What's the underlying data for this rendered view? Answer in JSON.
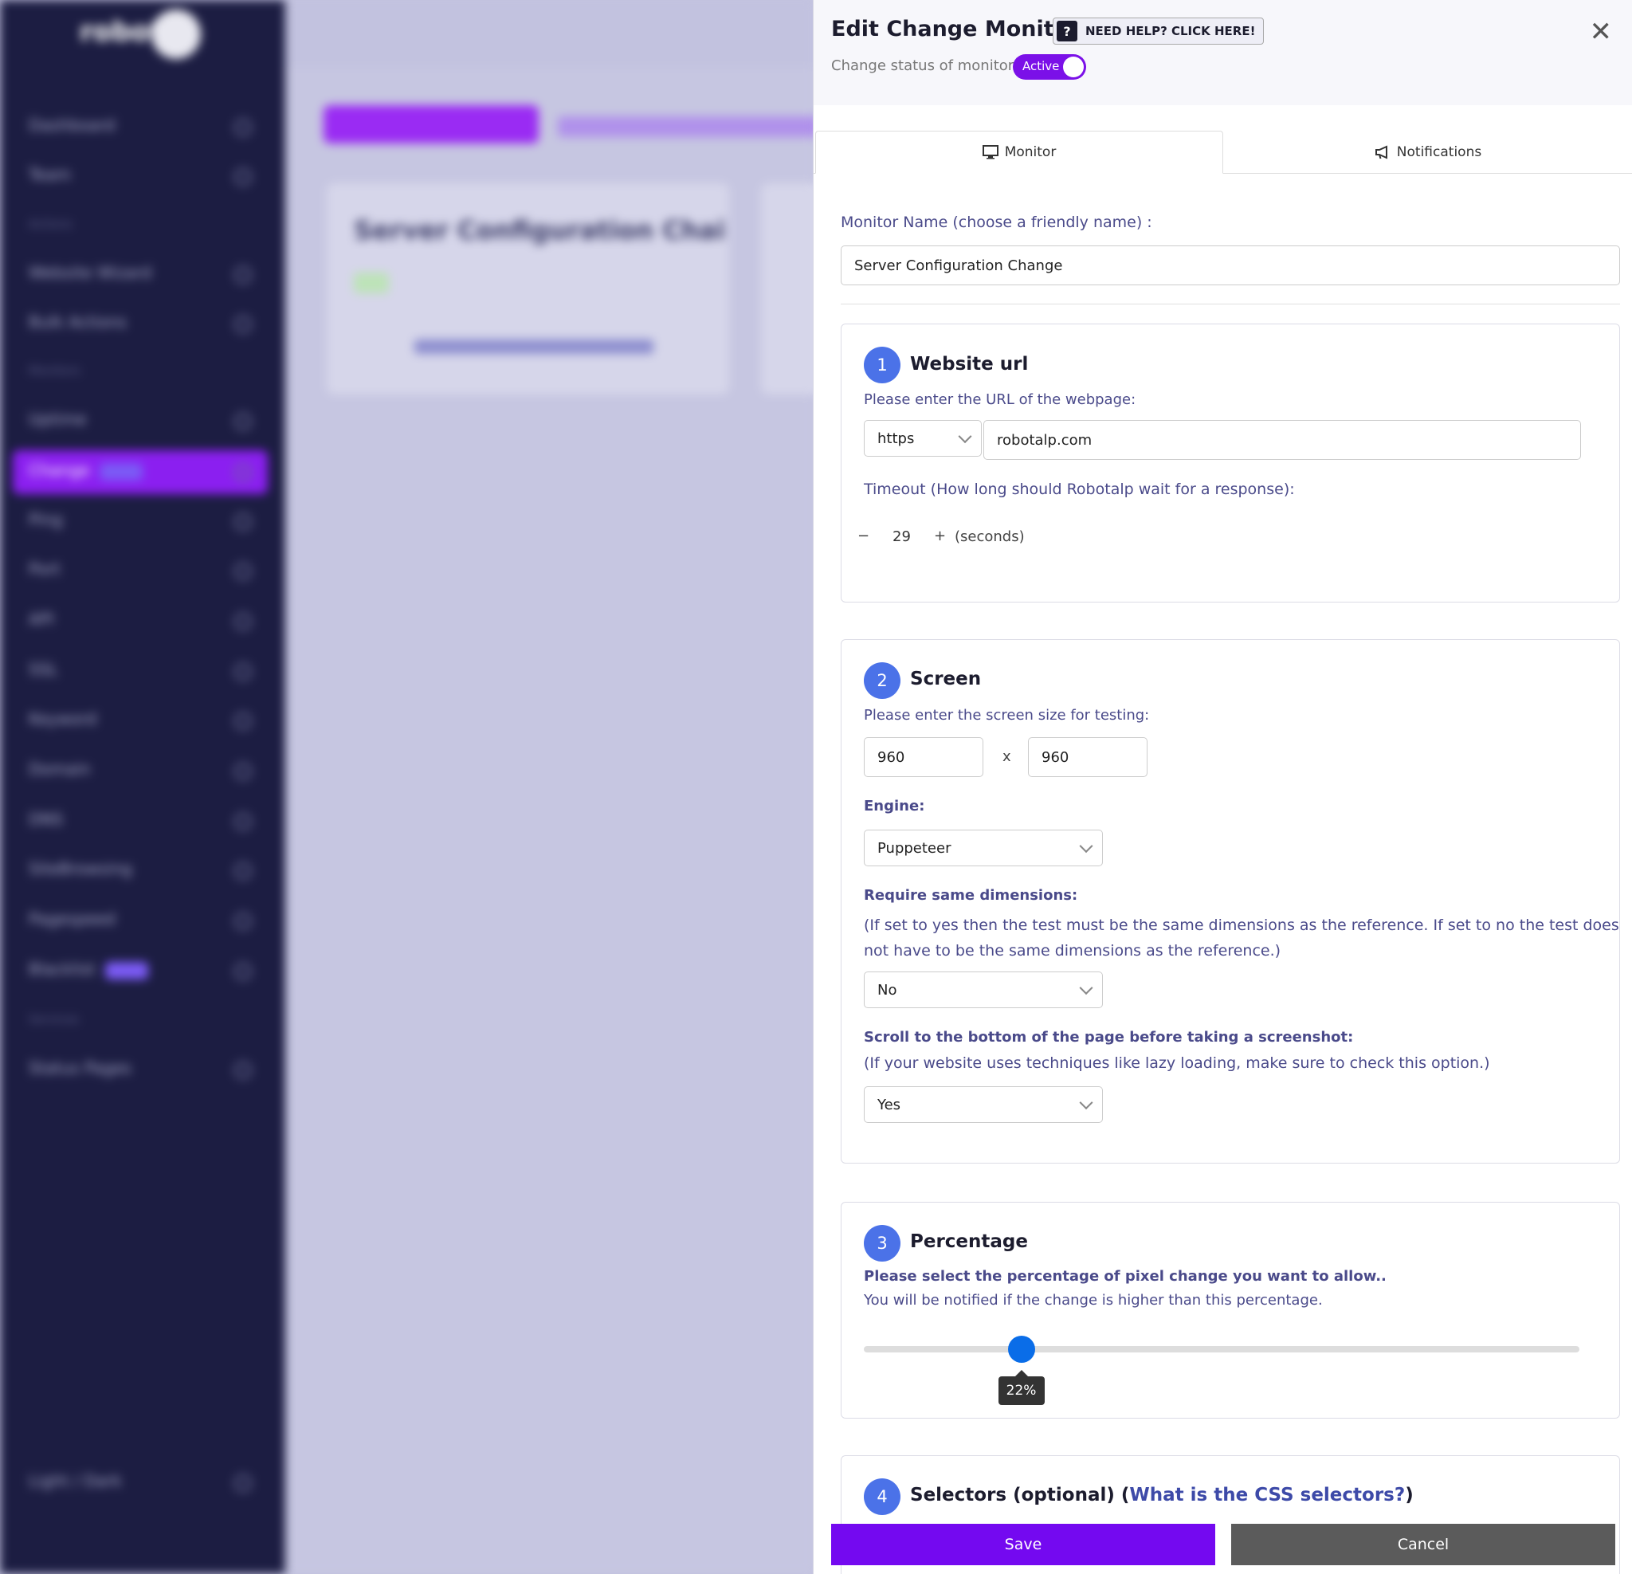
{
  "panel": {
    "title": "Edit Change Monitor",
    "help_button": "NEED HELP? CLICK HERE!",
    "help_icon_glyph": "?",
    "close_glyph": "✕",
    "status_label": "Change status of monitor:",
    "status_toggle": "Active"
  },
  "tabs": [
    {
      "label": "Monitor",
      "icon": "monitor-icon",
      "active": true
    },
    {
      "label": "Notifications",
      "icon": "megaphone-icon",
      "active": false
    }
  ],
  "monitor_name": {
    "label": "Monitor Name (choose a friendly name) :",
    "value": "Server Configuration Change"
  },
  "website_url": {
    "step": "1",
    "title": "Website url",
    "hint": "Please enter the URL of the webpage:",
    "protocol": "https",
    "url": "robotalp.com",
    "timeout_label": "Timeout (How long should Robotalp wait for a response):",
    "timeout_minus": "−",
    "timeout_value": "29",
    "timeout_plus": "+",
    "timeout_unit": "(seconds)"
  },
  "screen": {
    "step": "2",
    "title": "Screen",
    "hint": "Please enter the screen size for testing:",
    "width": "960",
    "separator": "x",
    "height": "960",
    "engine_label": "Engine:",
    "engine_value": "Puppeteer",
    "dimensions_label": "Require same dimensions:",
    "dimensions_hint_line1": "(If set to yes then the test must be the same dimensions as the reference. If set to no the test does",
    "dimensions_hint_line2": "not have to be the same dimensions as the reference.)",
    "dimensions_value": "No",
    "scroll_label": "Scroll to the bottom of the page before taking a screenshot:",
    "scroll_hint": "(If your website uses techniques like lazy loading, make sure to check this option.)",
    "scroll_value": "Yes"
  },
  "percentage": {
    "step": "3",
    "title": "Percentage",
    "hint_bold": "Please select the percentage of pixel change you want to allow..",
    "hint": "You will be notified if the change is higher than this percentage.",
    "value": 22,
    "value_label": "22%"
  },
  "selectors": {
    "step": "4",
    "title_prefix": "Selectors (optional) (",
    "title_link": "What is the CSS selectors?",
    "title_suffix": ")"
  },
  "footer": {
    "save": "Save",
    "cancel": "Cancel"
  },
  "background": {
    "logo": "robot",
    "card_title": "Server Configuration Chai",
    "sidebar_items": [
      "Dashboard",
      "Team",
      "Actions",
      "Website Wizard",
      "Bulk Actions",
      "Monitors",
      "Uptime",
      "Change",
      "Ping",
      "Port",
      "API",
      "SSL",
      "Keyword",
      "Domain",
      "DNS",
      "SiteBrowsing",
      "Pagespeed",
      "Blacklist",
      "Services",
      "Status Pages",
      "Light / Dark"
    ]
  },
  "colors": {
    "accent": "#7409f0",
    "step_badge": "#4b72e8",
    "slider": "#0a6de8",
    "sidebar": "#1c1d42"
  }
}
